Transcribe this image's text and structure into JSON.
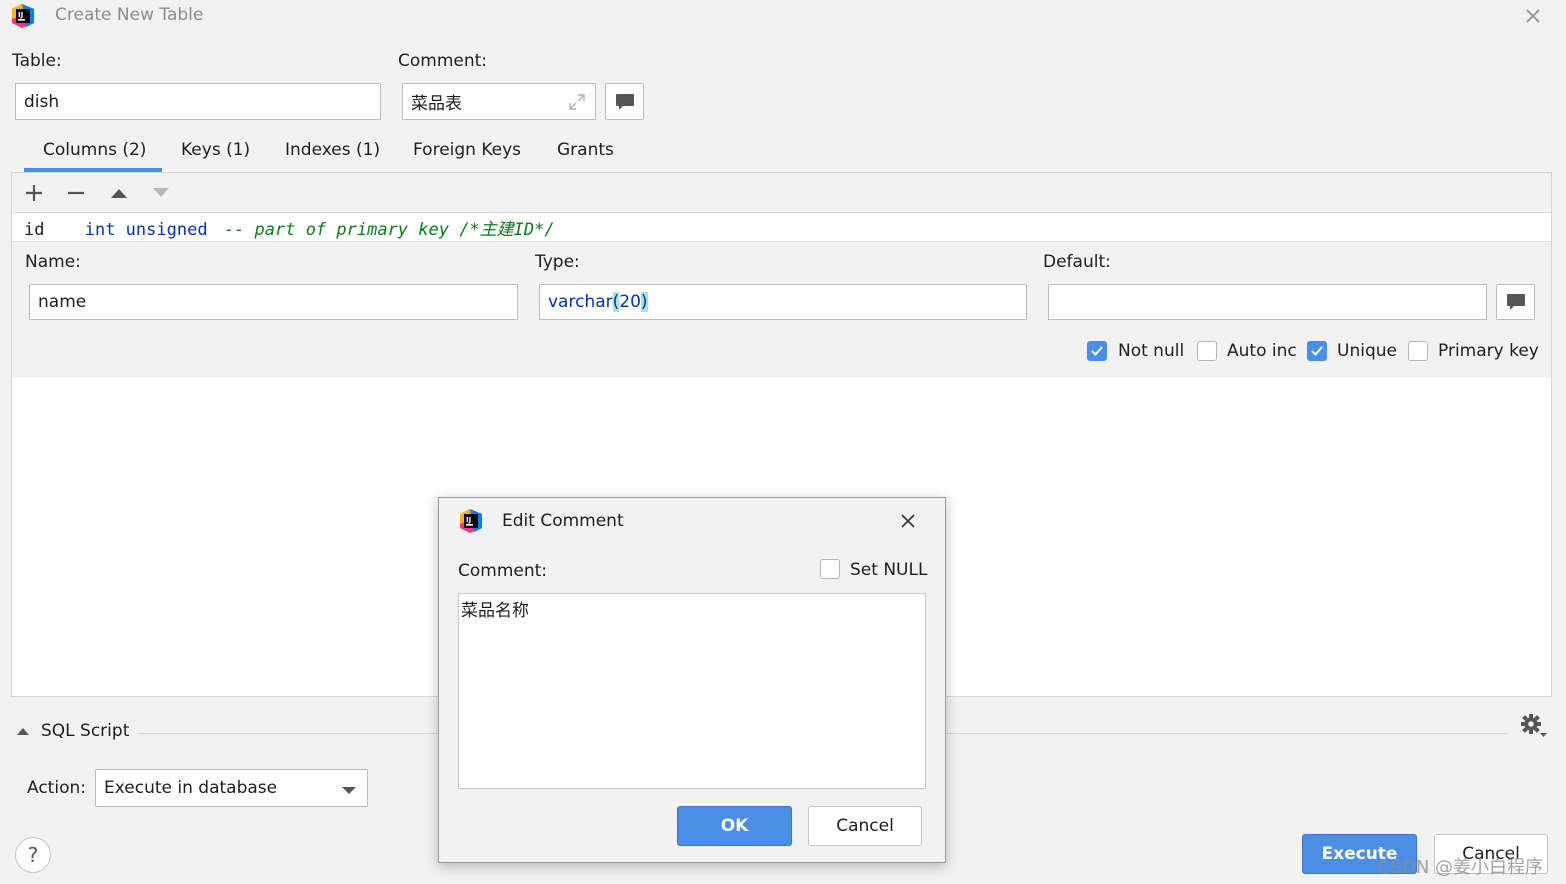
{
  "window": {
    "title": "Create New Table"
  },
  "table": {
    "label": "Table:",
    "value": "dish"
  },
  "comment": {
    "label": "Comment:",
    "value": "菜品表"
  },
  "tabs": [
    {
      "label": "Columns (2)"
    },
    {
      "label": "Keys (1)"
    },
    {
      "label": "Indexes (1)"
    },
    {
      "label": "Foreign Keys"
    },
    {
      "label": "Grants"
    }
  ],
  "column_row": {
    "name": "id",
    "type": "int unsigned",
    "comment": "-- part of primary key /*主建ID*/"
  },
  "column_editor": {
    "name_label": "Name:",
    "name_value": "name",
    "type_label": "Type:",
    "type_base": "varchar",
    "type_open": "(",
    "type_arg": "20",
    "type_close": ")",
    "default_label": "Default:",
    "default_value": "",
    "not_null": "Not null",
    "auto_inc": "Auto inc",
    "unique": "Unique",
    "primary_key": "Primary key"
  },
  "sql_script": {
    "label": "SQL Script",
    "action_label": "Action:",
    "action_value": "Execute in database"
  },
  "buttons": {
    "execute": "Execute",
    "cancel": "Cancel",
    "help": "?"
  },
  "dialog": {
    "title": "Edit Comment",
    "comment_label": "Comment:",
    "set_null": "Set NULL",
    "text": "菜品名称",
    "ok": "OK",
    "cancel": "Cancel"
  },
  "watermark": "CSDN @姜小白程序",
  "colors": {
    "accent": "#4a8ee8",
    "keyword": "#0033b3",
    "comment": "#067d17"
  }
}
